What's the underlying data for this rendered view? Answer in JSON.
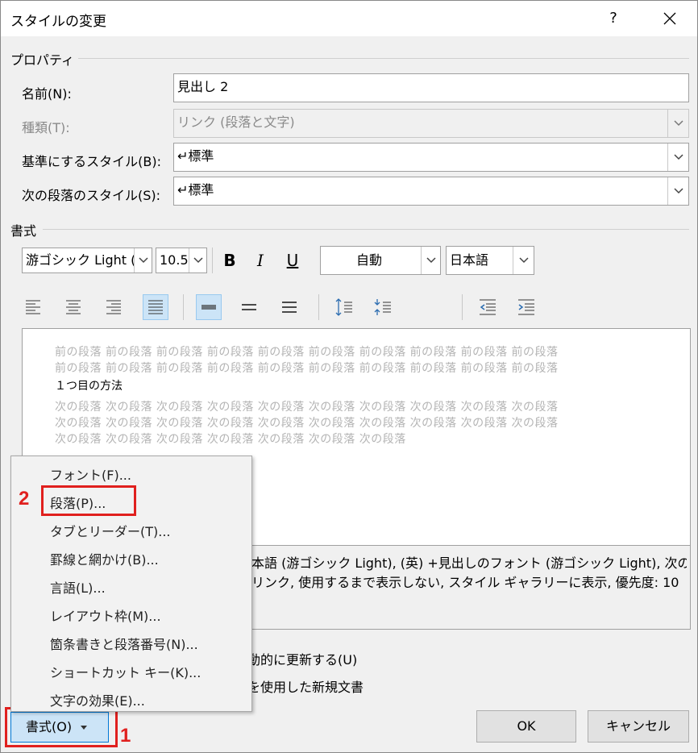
{
  "window": {
    "title": "スタイルの変更",
    "help": "?"
  },
  "properties": {
    "section": "プロパティ",
    "name_label": "名前(N):",
    "name_value": "見出し 2",
    "type_label": "種類(T):",
    "type_value": "リンク (段落と文字)",
    "based_label": "基準にするスタイル(B):",
    "based_value": "↵標準",
    "next_label": "次の段落のスタイル(S):",
    "next_value": "↵標準"
  },
  "format": {
    "section": "書式",
    "font": "游ゴシック Light (",
    "size": "10.5",
    "bold": "B",
    "italic": "I",
    "underline": "U",
    "color": "自動",
    "language": "日本語"
  },
  "preview": {
    "prev1": "前の段落 前の段落 前の段落 前の段落 前の段落 前の段落 前の段落 前の段落 前の段落 前の段落",
    "prev2": "前の段落 前の段落 前の段落 前の段落 前の段落 前の段落 前の段落 前の段落 前の段落 前の段落",
    "main": "１つ目の方法",
    "next1": "次の段落 次の段落 次の段落 次の段落 次の段落 次の段落 次の段落 次の段落 次の段落 次の段落",
    "next2": "次の段落 次の段落 次の段落 次の段落 次の段落 次の段落 次の段落 次の段落 次の段落 次の段落",
    "next3": "次の段落 次の段落 次の段落 次の段落 次の段落 次の段落 次の段落"
  },
  "description": {
    "line1": "本語 (游ゴシック Light), (英) +見出しのフォント (游ゴシック Light), 次の",
    "line2": "リンク, 使用するまで表示しない, スタイル ギャラリーに表示, 優先度: 10"
  },
  "options": {
    "auto_update": "動的に更新する(U)",
    "new_doc": "を使用した新規文書"
  },
  "menu": {
    "items": [
      "フォント(F)...",
      "段落(P)...",
      "タブとリーダー(T)...",
      "罫線と網かけ(B)...",
      "言語(L)...",
      "レイアウト枠(M)...",
      "箇条書きと段落番号(N)...",
      "ショートカット キー(K)...",
      "文字の効果(E)..."
    ]
  },
  "buttons": {
    "format": "書式(O)",
    "ok": "OK",
    "cancel": "キャンセル"
  },
  "annotations": {
    "step1": "1",
    "step2": "2"
  },
  "colors": {
    "highlight": "#e0201e",
    "accent_bg": "#cce4f7",
    "accent_border": "#0078d7"
  }
}
